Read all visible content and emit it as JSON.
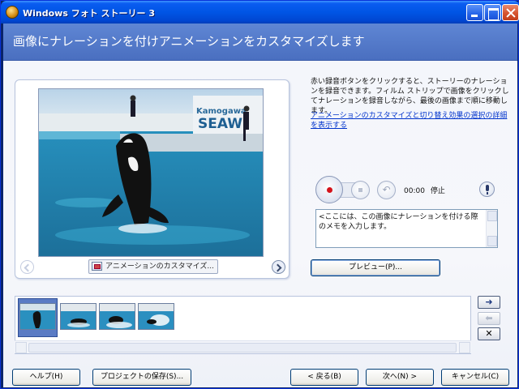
{
  "window": {
    "title": "Windows フォト ストーリー 3"
  },
  "header": {
    "title": "画像にナレーションを付けアニメーションをカスタマイズします"
  },
  "photo_panel": {
    "customize_label": "アニメーションのカスタマイズ..."
  },
  "instructions": {
    "text": "赤い録音ボタンをクリックすると、ストーリーのナレーションを録音できます。フィルム ストリップで画像をクリックしてナレーションを録音しながら、最後の画像まで順に移動します。",
    "details_link": "アニメーションのカスタマイズと切り替え効果の選択の詳細を表示する"
  },
  "recorder": {
    "time": "00:00",
    "status": "停止"
  },
  "notes": {
    "value": "<ここには、この画像にナレーションを付ける際のメモを入力します。"
  },
  "preview_button": "プレビュー(P)...",
  "buttons": {
    "help": "ヘルプ(H)",
    "save": "プロジェクトの保存(S)...",
    "back": "< 戻る(B)",
    "next": "次へ(N) >",
    "cancel": "キャンセル(C)"
  },
  "filmstrip": {
    "thumbnail_count": 4,
    "selected_index": 0
  },
  "colors": {
    "titlebar": "#0055e5",
    "header": "#5f86d4",
    "record": "#d4121a",
    "link": "#0033cc"
  }
}
